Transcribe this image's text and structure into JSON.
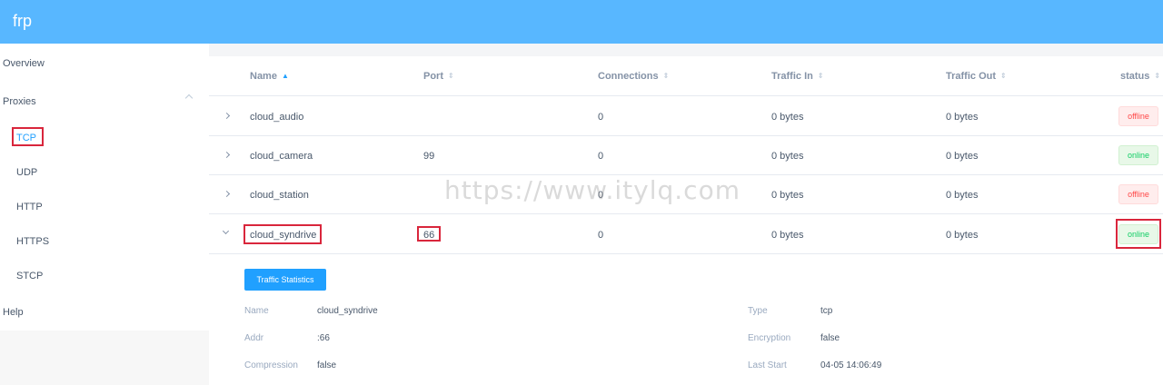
{
  "app": {
    "title": "frp"
  },
  "sidebar": {
    "items": [
      {
        "label": "Overview"
      },
      {
        "label": "Proxies"
      },
      {
        "label": "Help"
      }
    ],
    "proxy_types": [
      {
        "label": "TCP"
      },
      {
        "label": "UDP"
      },
      {
        "label": "HTTP"
      },
      {
        "label": "HTTPS"
      },
      {
        "label": "STCP"
      }
    ]
  },
  "table": {
    "columns": [
      {
        "label": "Name"
      },
      {
        "label": "Port"
      },
      {
        "label": "Connections"
      },
      {
        "label": "Traffic In"
      },
      {
        "label": "Traffic Out"
      },
      {
        "label": "status"
      }
    ],
    "rows": [
      {
        "name": "cloud_audio",
        "port": "",
        "connections": "0",
        "traffic_in": "0 bytes",
        "traffic_out": "0 bytes",
        "status": "offline"
      },
      {
        "name": "cloud_camera",
        "port": "99",
        "connections": "0",
        "traffic_in": "0 bytes",
        "traffic_out": "0 bytes",
        "status": "online"
      },
      {
        "name": "cloud_station",
        "port": "",
        "connections": "0",
        "traffic_in": "0 bytes",
        "traffic_out": "0 bytes",
        "status": "offline"
      },
      {
        "name": "cloud_syndrive",
        "port": "66",
        "connections": "0",
        "traffic_in": "0 bytes",
        "traffic_out": "0 bytes",
        "status": "online"
      }
    ]
  },
  "detail": {
    "button": "Traffic Statistics",
    "fields": {
      "name_label": "Name",
      "name_value": "cloud_syndrive",
      "addr_label": "Addr",
      "addr_value": ":66",
      "compression_label": "Compression",
      "compression_value": "false",
      "type_label": "Type",
      "type_value": "tcp",
      "encryption_label": "Encryption",
      "encryption_value": "false",
      "last_start_label": "Last Start",
      "last_start_value": "04-05 14:06:49"
    }
  },
  "watermark": "https://www.itylq.com",
  "colors": {
    "header": "#58b7ff",
    "accent": "#20a0ff",
    "online": "#13ce66",
    "offline": "#ff4949",
    "highlight": "#d9263c"
  }
}
